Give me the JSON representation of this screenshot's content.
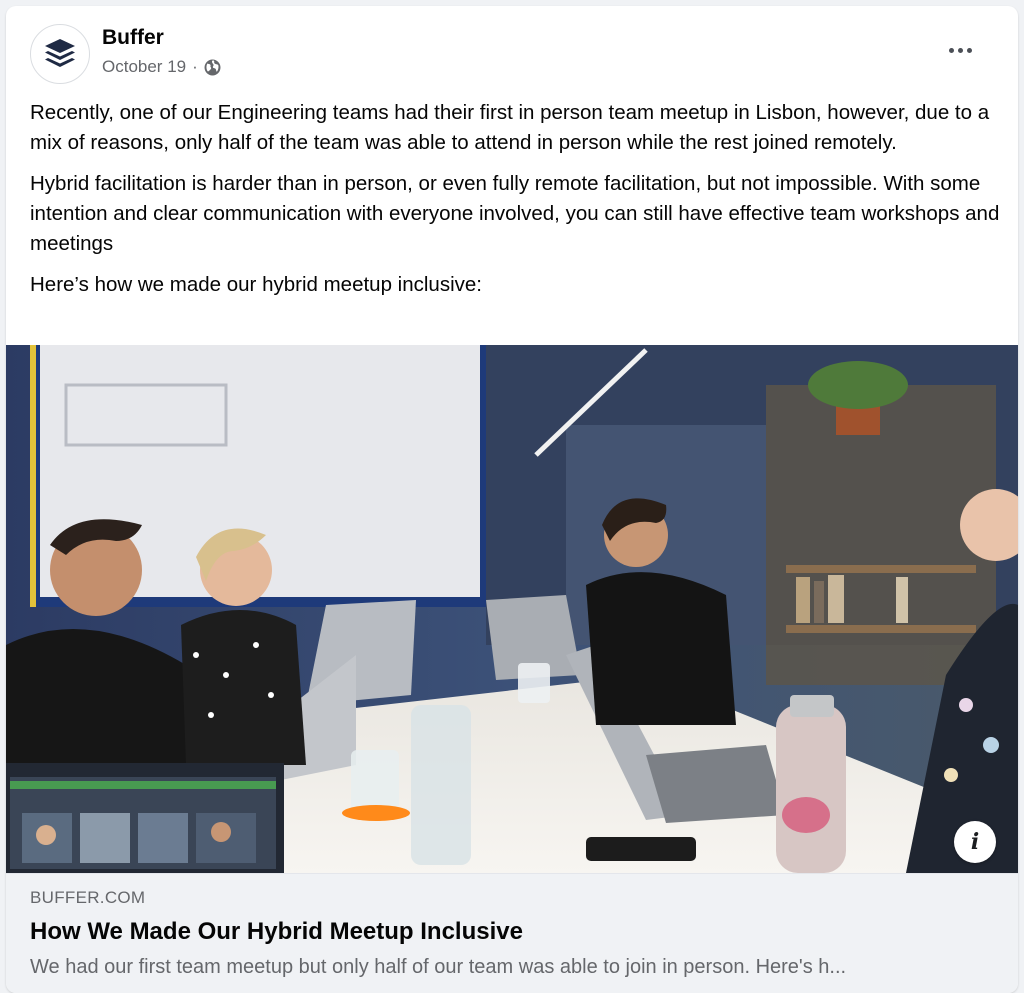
{
  "post": {
    "page_name": "Buffer",
    "date": "October 19",
    "separator": "·",
    "privacy_icon": "globe-icon",
    "more_icon": "more-options-icon",
    "paragraphs": [
      "Recently, one of our Engineering teams had their first in person team meetup in Lisbon, however, due to a mix of reasons, only half of the team was able to attend in person while the rest joined remotely.",
      "Hybrid facilitation is harder than in person, or even fully remote facilitation, but not impossible. With some intention and clear communication with everyone involved, you can still have effective team workshops and meetings",
      "Here’s how we made our hybrid meetup inclusive:"
    ]
  },
  "link_preview": {
    "domain": "BUFFER.COM",
    "title": "How We Made Our Hybrid Meetup Inclusive",
    "description": "We had our first team meetup but only half of our team was able to join in person. Here's h...",
    "info_icon": "info-icon",
    "info_label": "i"
  },
  "colors": {
    "brand": "#1f2a44",
    "secondary_text": "#65676b",
    "footer_bg": "#f0f2f5"
  }
}
